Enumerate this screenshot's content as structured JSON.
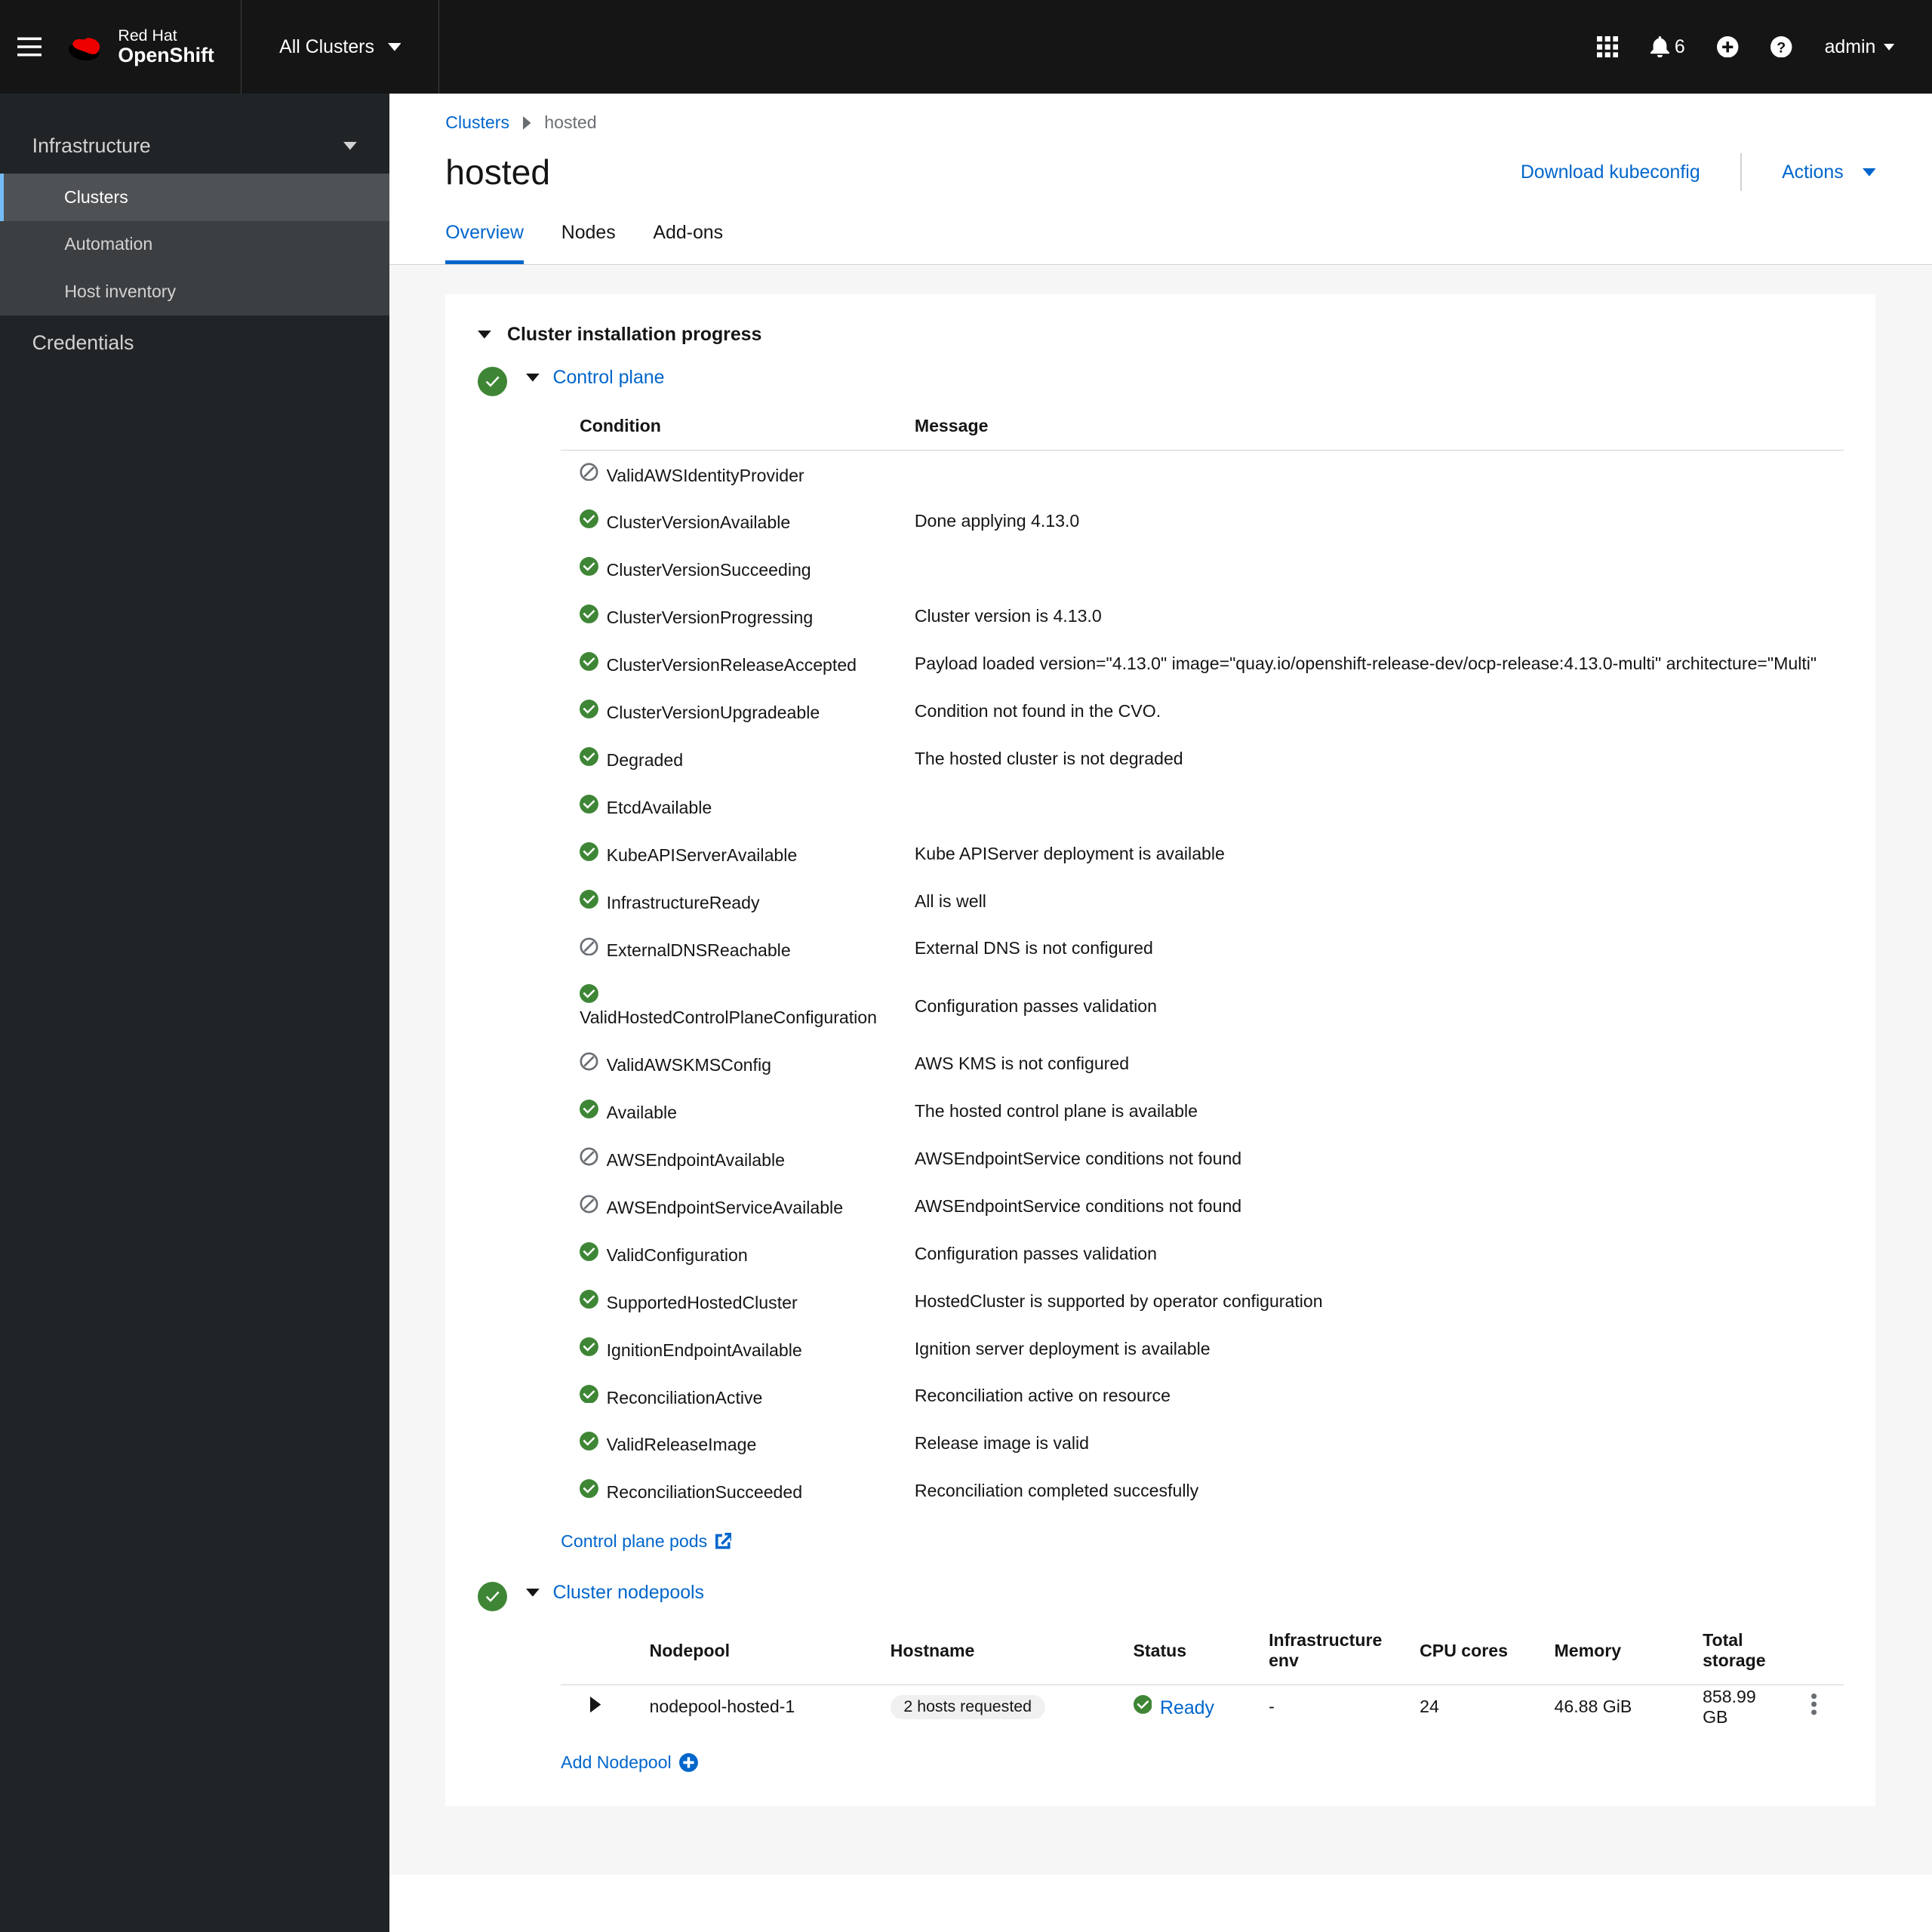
{
  "brand": {
    "product": "Red Hat",
    "subproduct": "OpenShift"
  },
  "clusterSwitch": {
    "label": "All Clusters"
  },
  "notifications": {
    "count": "6"
  },
  "user": {
    "name": "admin"
  },
  "sidebar": {
    "sections": [
      {
        "label": "Infrastructure",
        "expanded": true
      },
      {
        "label": "Credentials",
        "expanded": false
      }
    ],
    "infra_items": [
      {
        "label": "Clusters",
        "active": true
      },
      {
        "label": "Automation",
        "active": false
      },
      {
        "label": "Host inventory",
        "active": false
      }
    ]
  },
  "breadcrumb": {
    "root": "Clusters",
    "current": "hosted"
  },
  "pageTitle": "hosted",
  "tabs": [
    {
      "label": "Overview",
      "active": true
    },
    {
      "label": "Nodes",
      "active": false
    },
    {
      "label": "Add-ons",
      "active": false
    }
  ],
  "pageActions": {
    "download": "Download kubeconfig",
    "actions": "Actions"
  },
  "progress": {
    "title": "Cluster installation progress",
    "controlPlane": {
      "label": "Control plane",
      "headers": {
        "condition": "Condition",
        "message": "Message"
      },
      "rows": [
        {
          "status": "unknown",
          "condition": "ValidAWSIdentityProvider",
          "message": ""
        },
        {
          "status": "success",
          "condition": "ClusterVersionAvailable",
          "message": "Done applying 4.13.0"
        },
        {
          "status": "success",
          "condition": "ClusterVersionSucceeding",
          "message": ""
        },
        {
          "status": "success",
          "condition": "ClusterVersionProgressing",
          "message": "Cluster version is 4.13.0"
        },
        {
          "status": "success",
          "condition": "ClusterVersionReleaseAccepted",
          "message": "Payload loaded version=\"4.13.0\" image=\"quay.io/openshift-release-dev/ocp-release:4.13.0-multi\" architecture=\"Multi\""
        },
        {
          "status": "success",
          "condition": "ClusterVersionUpgradeable",
          "message": "Condition not found in the CVO."
        },
        {
          "status": "success",
          "condition": "Degraded",
          "message": "The hosted cluster is not degraded"
        },
        {
          "status": "success",
          "condition": "EtcdAvailable",
          "message": ""
        },
        {
          "status": "success",
          "condition": "KubeAPIServerAvailable",
          "message": "Kube APIServer deployment is available"
        },
        {
          "status": "success",
          "condition": "InfrastructureReady",
          "message": "All is well"
        },
        {
          "status": "unknown",
          "condition": "ExternalDNSReachable",
          "message": "External DNS is not configured"
        },
        {
          "status": "success",
          "condition": "ValidHostedControlPlaneConfiguration",
          "message": "Configuration passes validation"
        },
        {
          "status": "unknown",
          "condition": "ValidAWSKMSConfig",
          "message": "AWS KMS is not configured"
        },
        {
          "status": "success",
          "condition": "Available",
          "message": "The hosted control plane is available"
        },
        {
          "status": "unknown",
          "condition": "AWSEndpointAvailable",
          "message": "AWSEndpointService conditions not found"
        },
        {
          "status": "unknown",
          "condition": "AWSEndpointServiceAvailable",
          "message": "AWSEndpointService conditions not found"
        },
        {
          "status": "success",
          "condition": "ValidConfiguration",
          "message": "Configuration passes validation"
        },
        {
          "status": "success",
          "condition": "SupportedHostedCluster",
          "message": "HostedCluster is supported by operator configuration"
        },
        {
          "status": "success",
          "condition": "IgnitionEndpointAvailable",
          "message": "Ignition server deployment is available"
        },
        {
          "status": "success",
          "condition": "ReconciliationActive",
          "message": "Reconciliation active on resource"
        },
        {
          "status": "success",
          "condition": "ValidReleaseImage",
          "message": "Release image is valid"
        },
        {
          "status": "success",
          "condition": "ReconciliationSucceeded",
          "message": "Reconciliation completed succesfully"
        }
      ],
      "podsLink": "Control plane pods"
    },
    "nodepools": {
      "label": "Cluster nodepools",
      "headers": {
        "nodepool": "Nodepool",
        "hostname": "Hostname",
        "status": "Status",
        "infraEnv": "Infrastructure env",
        "cpu": "CPU cores",
        "memory": "Memory",
        "storage": "Total storage"
      },
      "rows": [
        {
          "name": "nodepool-hosted-1",
          "hostsBadge": "2 hosts requested",
          "status": "Ready",
          "infraEnv": "-",
          "cpu": "24",
          "memory": "46.88 GiB",
          "storage": "858.99 GB"
        }
      ],
      "addLabel": "Add Nodepool"
    }
  }
}
